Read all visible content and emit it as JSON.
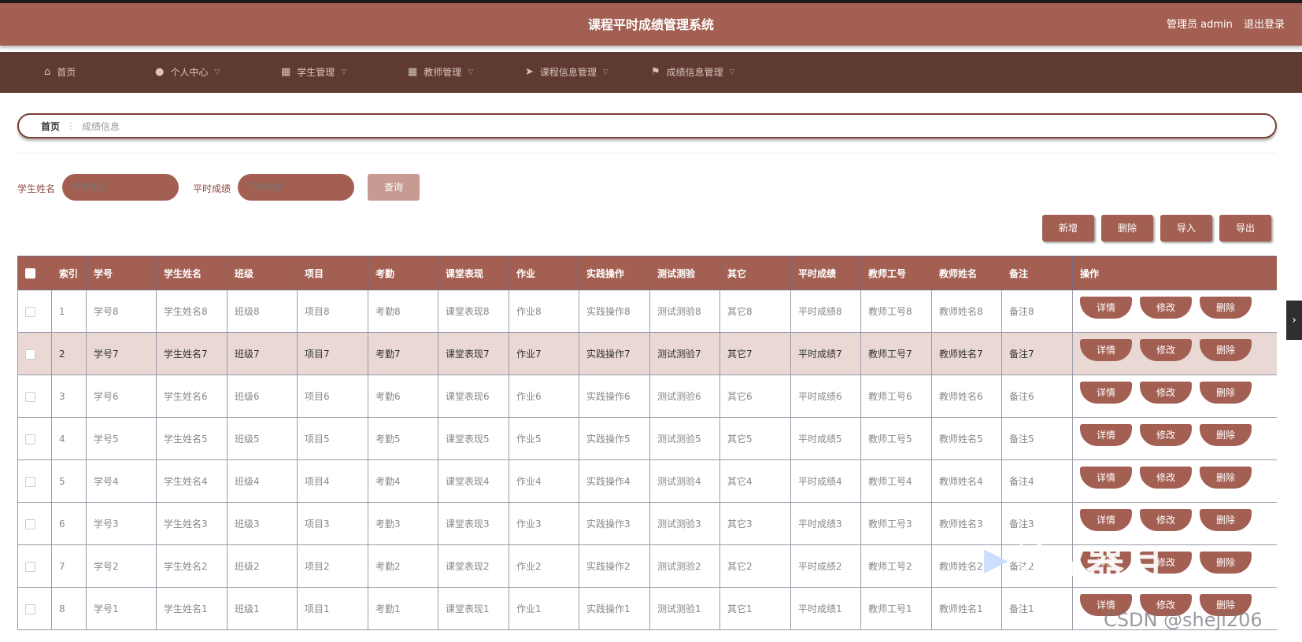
{
  "header": {
    "title": "课程平时成绩管理系统",
    "user": "管理员 admin",
    "logout": "退出登录"
  },
  "nav": [
    {
      "label": "首页",
      "icon": "home-icon",
      "dropdown": false
    },
    {
      "label": "个人中心",
      "icon": "user-icon",
      "dropdown": true
    },
    {
      "label": "学生管理",
      "icon": "grid-icon",
      "dropdown": true
    },
    {
      "label": "教师管理",
      "icon": "grid-icon",
      "dropdown": true
    },
    {
      "label": "课程信息管理",
      "icon": "send-icon",
      "dropdown": true
    },
    {
      "label": "成绩信息管理",
      "icon": "flag-icon",
      "dropdown": true
    }
  ],
  "breadcrumb": {
    "home": "首页",
    "current": "成绩信息"
  },
  "search": {
    "name_label": "学生姓名",
    "name_placeholder": "学生姓名",
    "score_label": "平时成绩",
    "score_placeholder": "平时成绩",
    "query": "查询"
  },
  "actions": {
    "add": "新增",
    "delete": "删除",
    "import": "导入",
    "export": "导出"
  },
  "table": {
    "headers": [
      "索引",
      "学号",
      "学生姓名",
      "班级",
      "项目",
      "考勤",
      "课堂表现",
      "作业",
      "实践操作",
      "测试测验",
      "其它",
      "平时成绩",
      "教师工号",
      "教师姓名",
      "备注",
      "操作"
    ],
    "rows": [
      {
        "i": "1",
        "c": [
          "学号8",
          "学生姓名8",
          "班级8",
          "项目8",
          "考勤8",
          "课堂表现8",
          "作业8",
          "实践操作8",
          "测试测验8",
          "其它8",
          "平时成绩8",
          "教师工号8",
          "教师姓名8",
          "备注8"
        ]
      },
      {
        "i": "2",
        "c": [
          "学号7",
          "学生姓名7",
          "班级7",
          "项目7",
          "考勤7",
          "课堂表现7",
          "作业7",
          "实践操作7",
          "测试测验7",
          "其它7",
          "平时成绩7",
          "教师工号7",
          "教师姓名7",
          "备注7"
        ]
      },
      {
        "i": "3",
        "c": [
          "学号6",
          "学生姓名6",
          "班级6",
          "项目6",
          "考勤6",
          "课堂表现6",
          "作业6",
          "实践操作6",
          "测试测验6",
          "其它6",
          "平时成绩6",
          "教师工号6",
          "教师姓名6",
          "备注6"
        ]
      },
      {
        "i": "4",
        "c": [
          "学号5",
          "学生姓名5",
          "班级5",
          "项目5",
          "考勤5",
          "课堂表现5",
          "作业5",
          "实践操作5",
          "测试测验5",
          "其它5",
          "平时成绩5",
          "教师工号5",
          "教师姓名5",
          "备注5"
        ]
      },
      {
        "i": "5",
        "c": [
          "学号4",
          "学生姓名4",
          "班级4",
          "项目4",
          "考勤4",
          "课堂表现4",
          "作业4",
          "实践操作4",
          "测试测验4",
          "其它4",
          "平时成绩4",
          "教师工号4",
          "教师姓名4",
          "备注4"
        ]
      },
      {
        "i": "6",
        "c": [
          "学号3",
          "学生姓名3",
          "班级3",
          "项目3",
          "考勤3",
          "课堂表现3",
          "作业3",
          "实践操作3",
          "测试测验3",
          "其它3",
          "平时成绩3",
          "教师工号3",
          "教师姓名3",
          "备注3"
        ]
      },
      {
        "i": "7",
        "c": [
          "学号2",
          "学生姓名2",
          "班级2",
          "项目2",
          "考勤2",
          "课堂表现2",
          "作业2",
          "实践操作2",
          "测试测验2",
          "其它2",
          "平时成绩2",
          "教师工号2",
          "教师姓名2",
          "备注2"
        ]
      },
      {
        "i": "8",
        "c": [
          "学号1",
          "学生姓名1",
          "班级1",
          "项目1",
          "考勤1",
          "课堂表现1",
          "作业1",
          "实践操作1",
          "测试测验1",
          "其它1",
          "平时成绩1",
          "教师工号1",
          "教师姓名1",
          "备注1"
        ]
      }
    ],
    "highlighted_row": 1,
    "row_ops": {
      "detail": "详情",
      "edit": "修改",
      "delete": "删除"
    }
  },
  "watermark": "CSDN @sheji206",
  "overlay_logo": "沙V器目"
}
